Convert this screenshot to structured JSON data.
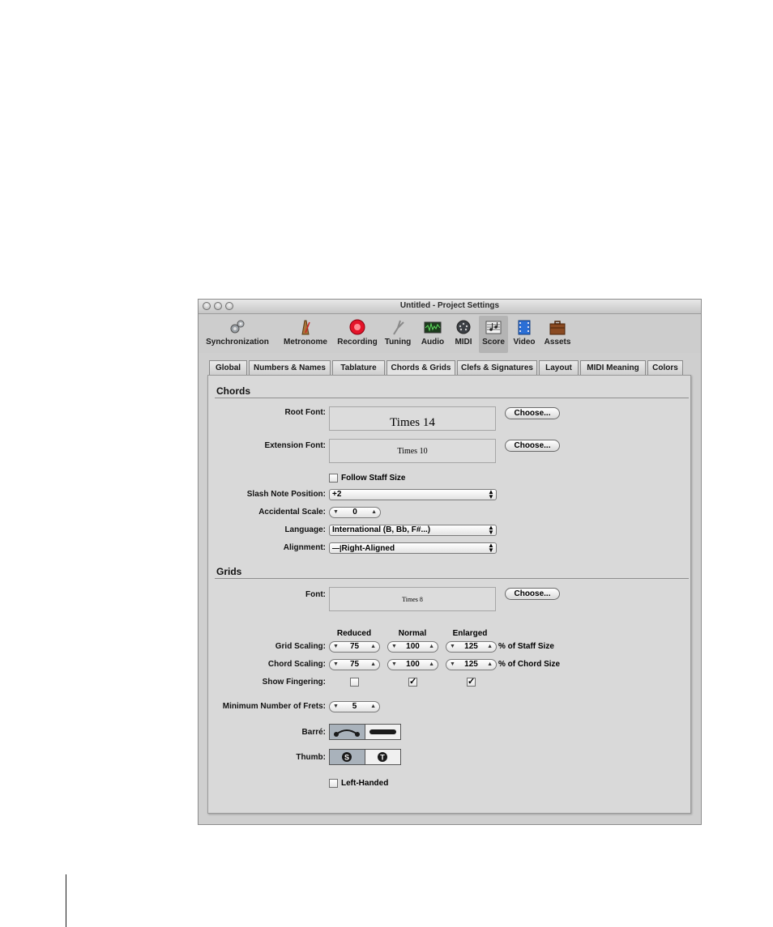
{
  "window": {
    "title": "Untitled - Project Settings"
  },
  "toolbar": {
    "items": [
      {
        "label": "Synchronization",
        "icon": "gears-icon"
      },
      {
        "label": "Metronome",
        "icon": "metronome-icon"
      },
      {
        "label": "Recording",
        "icon": "record-icon"
      },
      {
        "label": "Tuning",
        "icon": "tuning-fork-icon"
      },
      {
        "label": "Audio",
        "icon": "waveform-icon"
      },
      {
        "label": "MIDI",
        "icon": "midi-connector-icon"
      },
      {
        "label": "Score",
        "icon": "score-icon"
      },
      {
        "label": "Video",
        "icon": "film-icon"
      },
      {
        "label": "Assets",
        "icon": "briefcase-icon"
      }
    ],
    "selected": "Score"
  },
  "tabs": {
    "items": [
      "Global",
      "Numbers & Names",
      "Tablature",
      "Chords & Grids",
      "Clefs & Signatures",
      "Layout",
      "MIDI Meaning",
      "Colors"
    ],
    "active": "Chords & Grids"
  },
  "chords": {
    "heading": "Chords",
    "root_font": {
      "label": "Root Font:",
      "value": "Times 14",
      "button": "Choose..."
    },
    "extension_font": {
      "label": "Extension Font:",
      "value": "Times 10",
      "button": "Choose..."
    },
    "follow_staff_size": {
      "label": "Follow Staff Size",
      "checked": false
    },
    "slash_note_position": {
      "label": "Slash Note Position:",
      "value": "+2"
    },
    "accidental_scale": {
      "label": "Accidental Scale:",
      "value": "0"
    },
    "language": {
      "label": "Language:",
      "value": "International (B, Bb, F#...)"
    },
    "alignment": {
      "label": "Alignment:",
      "value": "Right-Aligned"
    }
  },
  "grids": {
    "heading": "Grids",
    "font": {
      "label": "Font:",
      "value": "Times 8",
      "button": "Choose..."
    },
    "columns": [
      "Reduced",
      "Normal",
      "Enlarged"
    ],
    "grid_scaling": {
      "label": "Grid Scaling:",
      "values": [
        "75",
        "100",
        "125"
      ],
      "suffix": "% of Staff Size"
    },
    "chord_scaling": {
      "label": "Chord Scaling:",
      "values": [
        "75",
        "100",
        "125"
      ],
      "suffix": "% of Chord Size"
    },
    "show_fingering": {
      "label": "Show Fingering:",
      "checked": [
        false,
        true,
        true
      ]
    },
    "min_frets": {
      "label": "Minimum Number of Frets:",
      "value": "5"
    },
    "barre": {
      "label": "Barré:",
      "selected_index": 0
    },
    "thumb": {
      "label": "Thumb:",
      "options": [
        "S",
        "T"
      ],
      "selected_index": 0
    },
    "left_handed": {
      "label": "Left-Handed",
      "checked": false
    }
  }
}
